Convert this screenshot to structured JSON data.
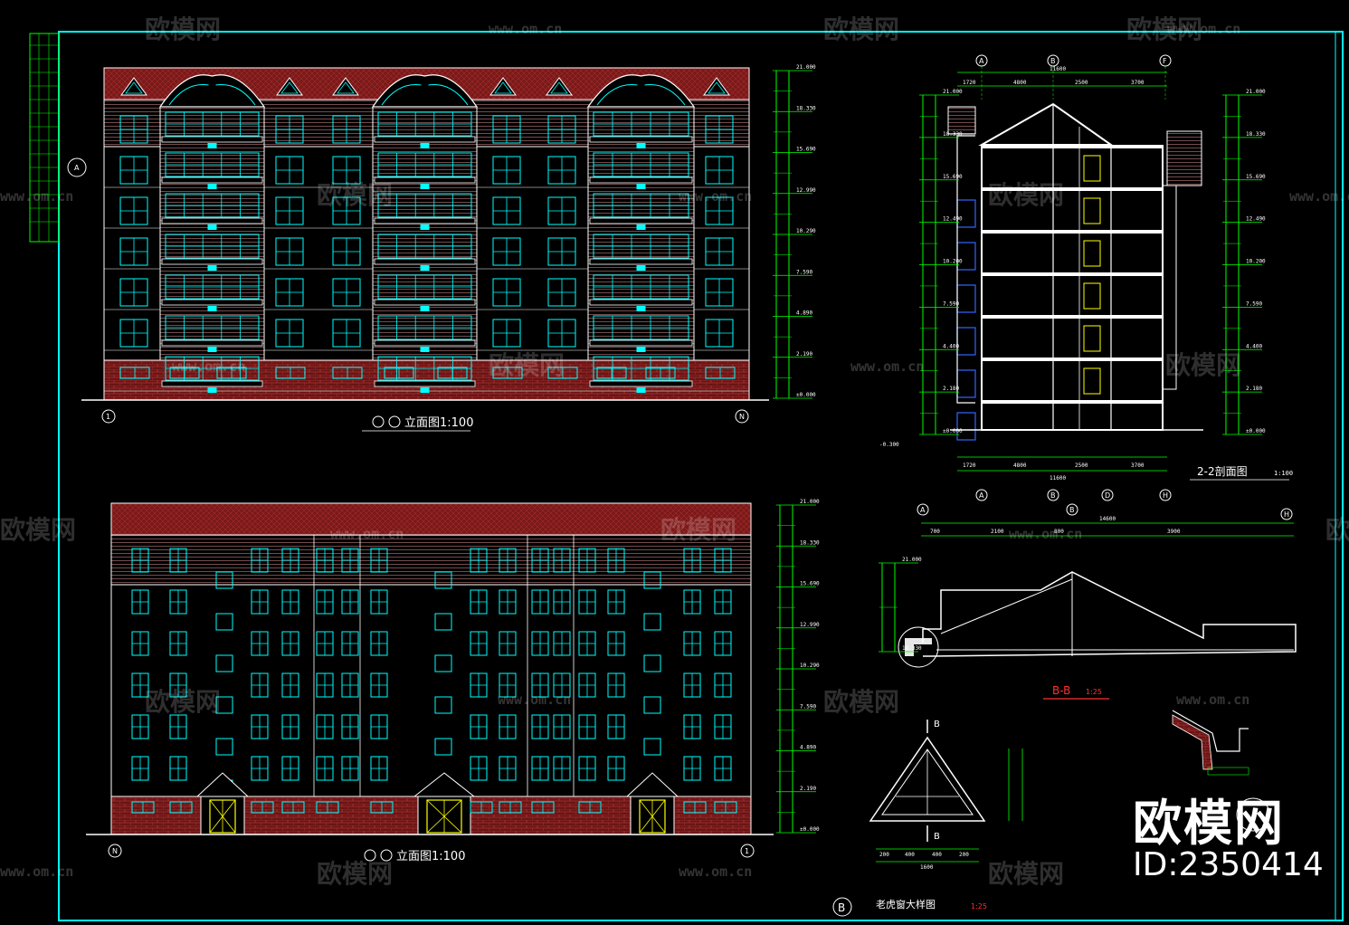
{
  "colors": {
    "background": "#000000",
    "frame": "#00ffff",
    "line": "#ffffff",
    "dimension": "#00ff00",
    "window": "#00ffff",
    "roof": "#8b1a1a",
    "brick": "#7a1c1c",
    "accent_red": "#ff3030",
    "door": "#ffff00"
  },
  "drawings": {
    "front_elevation": {
      "title": "立面图1:100",
      "axis_start": "1",
      "axis_end": "N"
    },
    "rear_elevation": {
      "title": "立面图1:100",
      "axis_start": "N",
      "axis_end": "1"
    },
    "section_2_2": {
      "title": "2-2剖面图",
      "scale": "1:100",
      "axes_top": [
        "A",
        "B",
        "F"
      ],
      "axes_bottom": [
        "A",
        "B",
        "D",
        "H"
      ],
      "dims_top": [
        "1720",
        "4800",
        "2500",
        "3700"
      ],
      "total_top": "11600",
      "dims_bottom": [
        "1720",
        "4800",
        "2500",
        "3700"
      ],
      "total_bottom": "11600",
      "levels": [
        "21.000",
        "18.330",
        "15.690",
        "12.490",
        "10.200",
        "7.590",
        "4.400",
        "2.180",
        "±0.000",
        "-0.300"
      ]
    },
    "section_b_b": {
      "title": "B-B",
      "scale": "1:25",
      "axes": [
        "A",
        "B",
        "H"
      ],
      "total": "14600",
      "dims": [
        "700",
        "2100",
        "800",
        "3900"
      ]
    },
    "dormer_detail": {
      "title": "老虎窗大样图",
      "scale": "1:25",
      "marker": "B",
      "cut_label": "B",
      "dims": [
        "200",
        "400",
        "400",
        "200"
      ],
      "total": "1600"
    }
  },
  "elevation_levels": [
    "21.000",
    "18.330",
    "15.690",
    "12.990",
    "10.290",
    "7.590",
    "4.890",
    "2.190",
    "±0.000"
  ],
  "watermark": {
    "brand": "欧模网",
    "url": "www.om.cn",
    "id_label": "ID:2350414"
  }
}
